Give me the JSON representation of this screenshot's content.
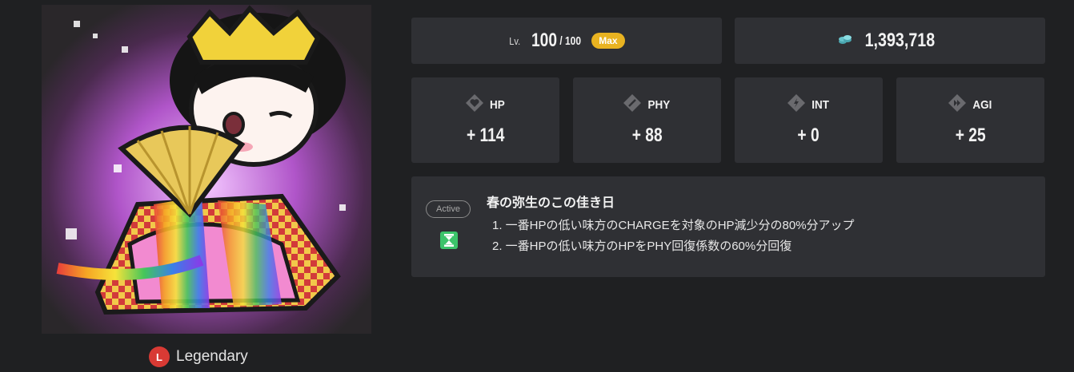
{
  "character": {
    "portrait_alt": "pixel-art heroine in rainbow kimono holding a golden folding fan",
    "rarity_letter": "L",
    "rarity_label": "Legendary",
    "rarity_color": "#d83a34"
  },
  "level": {
    "prefix": "Lv.",
    "current": "100",
    "max_text": "/ 100",
    "badge": "Max",
    "badge_color": "#e9b321"
  },
  "coins": {
    "icon": "coin-stack-icon",
    "value": "1,393,718"
  },
  "stats": [
    {
      "icon": "heart-icon",
      "name": "HP",
      "value": "+ 114"
    },
    {
      "icon": "sword-icon",
      "name": "PHY",
      "value": "+ 88"
    },
    {
      "icon": "lightning-icon",
      "name": "INT",
      "value": "+ 0"
    },
    {
      "icon": "speed-icon",
      "name": "AGI",
      "value": "+ 25"
    }
  ],
  "skill": {
    "type_tag": "Active",
    "type_icon": "hourglass-icon",
    "icon_color": "#3cc46a",
    "title": "春の弥生のこの佳き日",
    "effects": [
      "1. 一番HPの低い味方のCHARGEを対象のHP減少分の80%分アップ",
      "2. 一番HPの低い味方のHPをPHY回復係数の60%分回復"
    ]
  }
}
